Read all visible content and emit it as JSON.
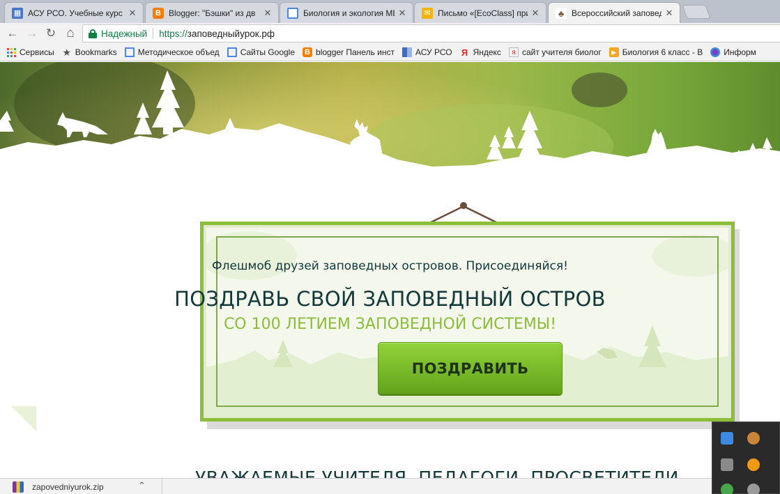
{
  "tabs": [
    {
      "title": "АСУ РСО. Учебные курс",
      "favicon": "asu-rso-favicon",
      "color": "#4a78c9",
      "active": false
    },
    {
      "title": "Blogger: \"Бэшки\" из дв",
      "favicon": "blogger-favicon",
      "color": "#f57d00",
      "active": false
    },
    {
      "title": "Биология и экология МБ",
      "favicon": "docs-favicon",
      "color": "#4a86e8",
      "active": false
    },
    {
      "title": "Письмо «[EcoClass] при",
      "favicon": "mail-favicon",
      "color": "#f5b400",
      "active": false
    },
    {
      "title": "Всероссийский заповед",
      "favicon": "squirrel-favicon",
      "color": "#7a5a3a",
      "active": true
    }
  ],
  "tab_close_glyph": "✕",
  "toolbar": {
    "back": "←",
    "forward": "→",
    "reload": "↻",
    "home": "⌂",
    "security_label": "Надежный",
    "url_scheme": "https://",
    "url_host": "заповедныйурок.рф"
  },
  "bookmarks": [
    {
      "label": "Сервисы",
      "icon": "apps-grid-icon"
    },
    {
      "label": "Bookmarks",
      "icon": "star-icon"
    },
    {
      "label": "Методическое объед",
      "icon": "sites-icon"
    },
    {
      "label": "Сайты Google",
      "icon": "sites-icon"
    },
    {
      "label": "blogger Панель инст",
      "icon": "blogger-icon"
    },
    {
      "label": "АСУ РСО",
      "icon": "asu-rso-icon"
    },
    {
      "label": "Яндекс",
      "icon": "yandex-icon"
    },
    {
      "label": "сайт учителя биолог",
      "icon": "yandex-page-icon"
    },
    {
      "label": "Биология 6 класс - В",
      "icon": "video-icon"
    },
    {
      "label": "Информ",
      "icon": "info-icon"
    }
  ],
  "sign": {
    "subtitle": "Флешмоб друзей заповедных островов. Присоединяйся!",
    "title": "ПОЗДРАВЬ СВОЙ ЗАПОВЕДНЫЙ ОСТРОВ",
    "tagline": "СО 100 ЛЕТИЕМ ЗАПОВЕДНОЙ СИСТЕМЫ!",
    "button": "ПОЗДРАВИТЬ"
  },
  "cut_heading": "УВАЖАЕМЫЕ УЧИТЕЛЯ, ПЕДАГОГИ, ПРОСВЕТИТЕЛИ",
  "download": {
    "filename": "zapovedniyurok.zip",
    "chevron": "⌃"
  },
  "colors": {
    "brand_green": "#8dbe3a",
    "dark_teal": "#12383a",
    "secure_green": "#0b8043"
  }
}
